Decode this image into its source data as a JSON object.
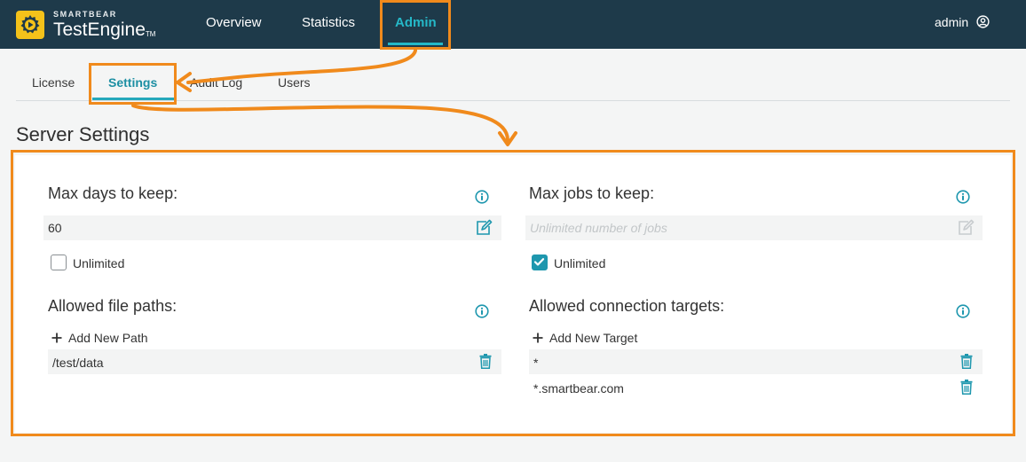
{
  "brand": {
    "company": "SMARTBEAR",
    "product": "TestEngine",
    "tm": "TM"
  },
  "nav": [
    {
      "label": "Overview"
    },
    {
      "label": "Statistics"
    },
    {
      "label": "Admin"
    }
  ],
  "user": {
    "name": "admin",
    "icon": "user-circle-icon"
  },
  "tabs": [
    {
      "label": "License"
    },
    {
      "label": "Settings"
    },
    {
      "label": "Audit Log"
    },
    {
      "label": "Users"
    }
  ],
  "page_title": "Server Settings",
  "settings": {
    "max_days": {
      "label": "Max days to keep:",
      "value": "60",
      "unlimited_label": "Unlimited",
      "unlimited": false
    },
    "max_jobs": {
      "label": "Max jobs to keep:",
      "placeholder": "Unlimited number of jobs",
      "unlimited_label": "Unlimited",
      "unlimited": true
    },
    "file_paths": {
      "label": "Allowed file paths:",
      "add_label": "Add New Path",
      "items": [
        "/test/data"
      ]
    },
    "targets": {
      "label": "Allowed connection targets:",
      "add_label": "Add New Target",
      "items": [
        "*",
        "*.smartbear.com"
      ]
    }
  },
  "colors": {
    "header": "#1e3a4a",
    "accent": "#25b8c8",
    "annotation": "#f08a1c",
    "logo": "#f4c21a"
  }
}
